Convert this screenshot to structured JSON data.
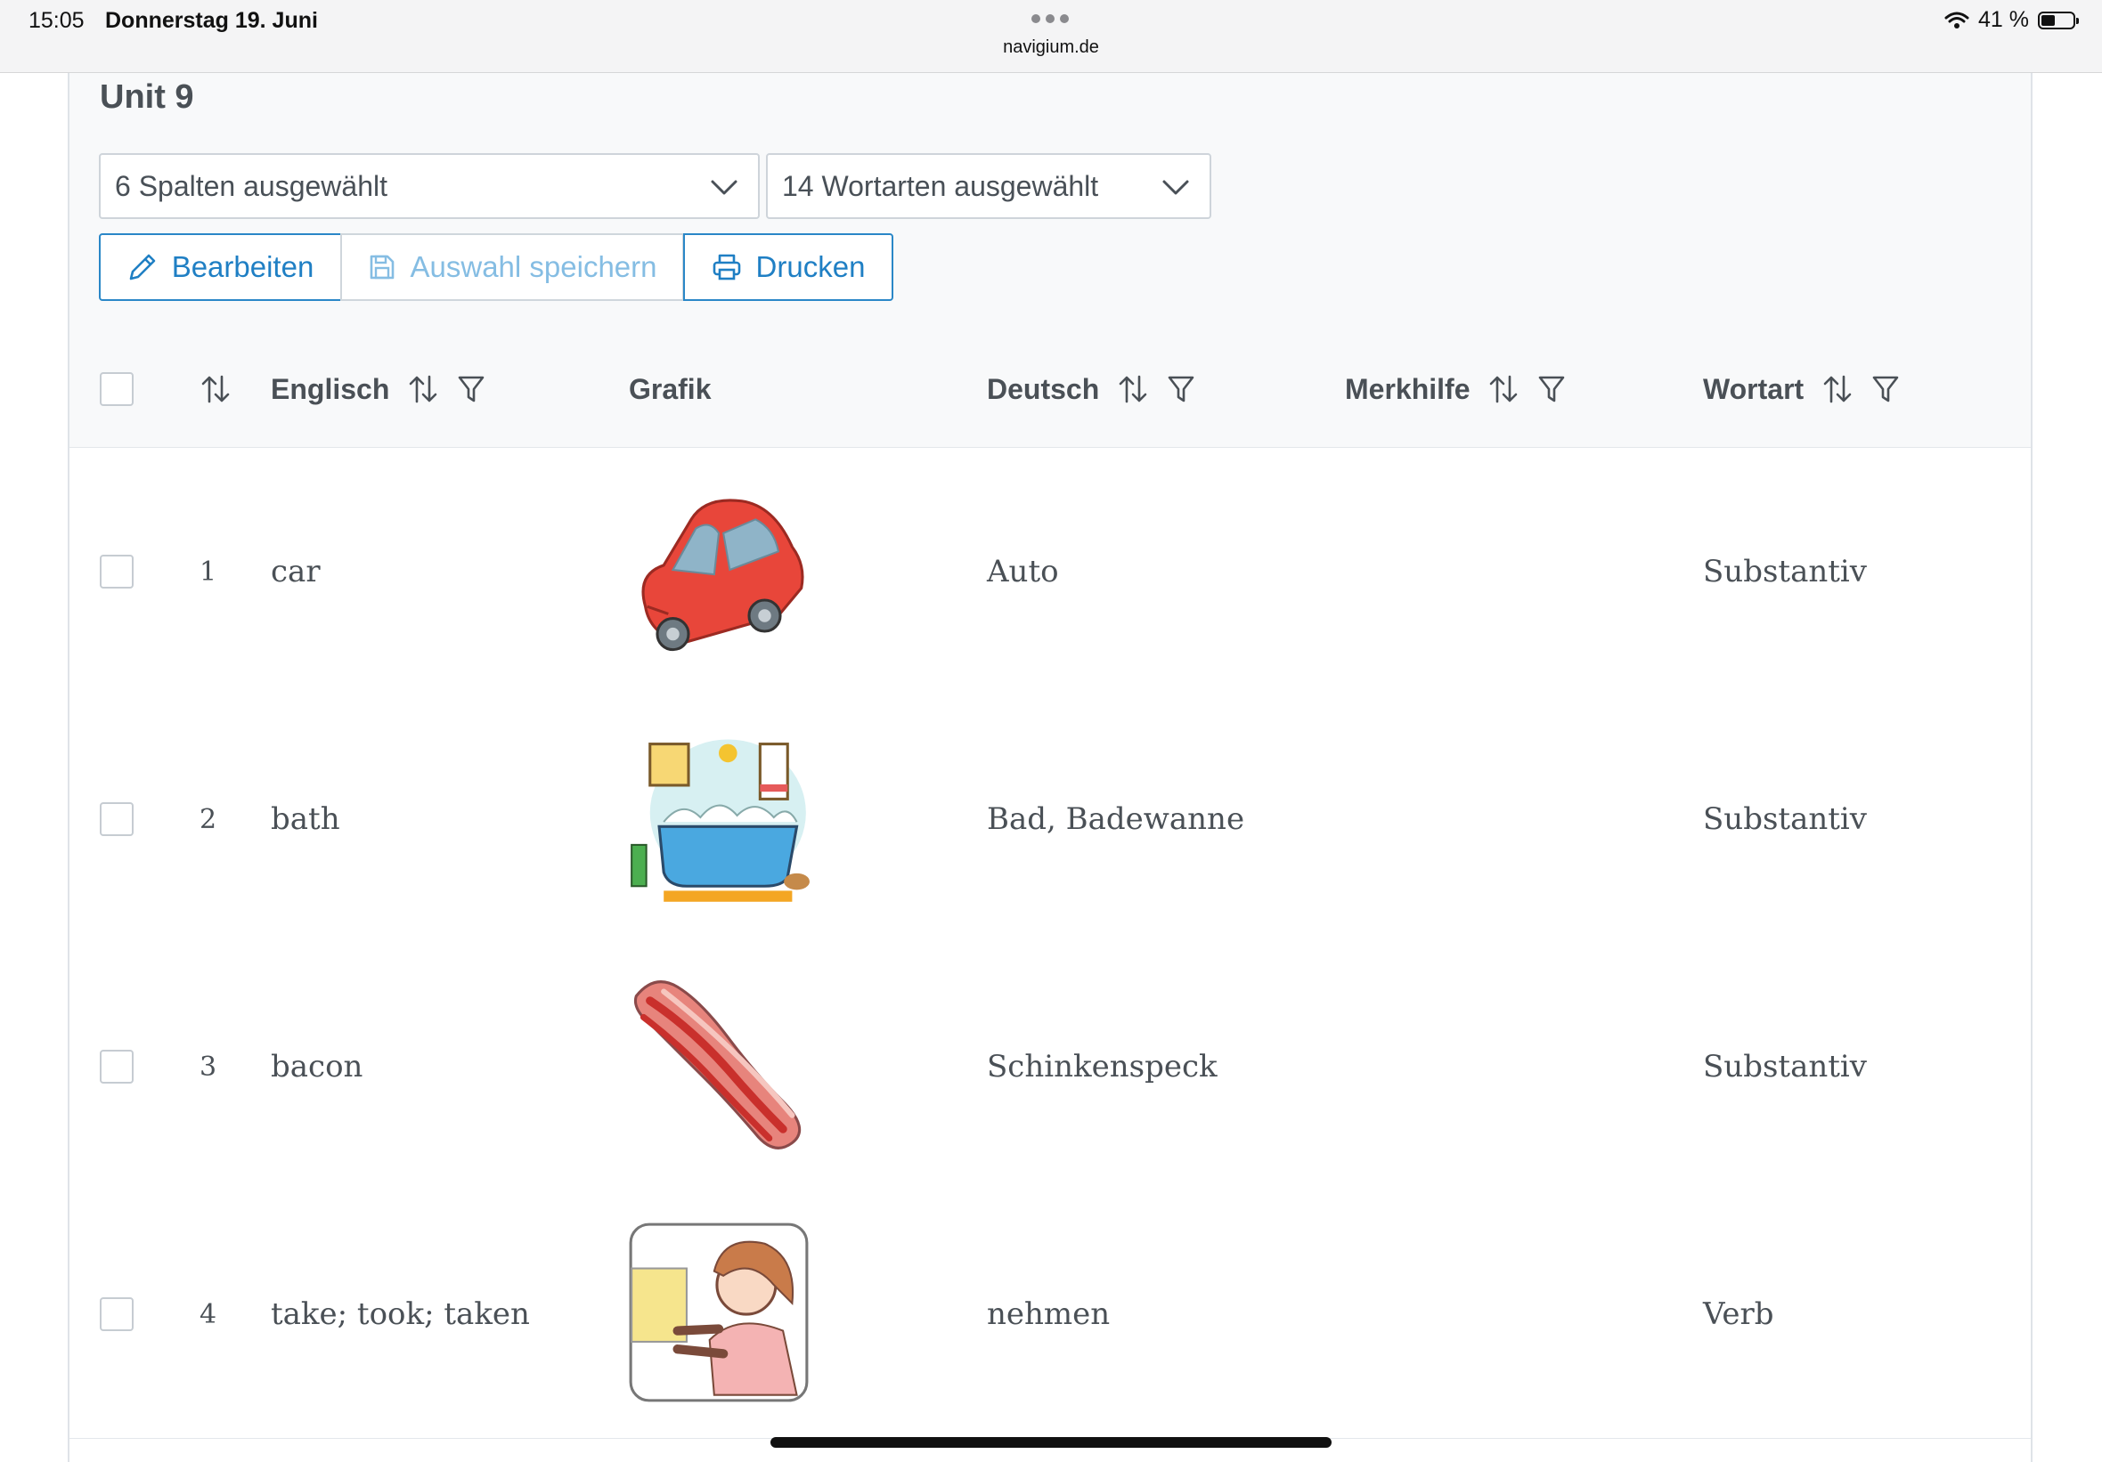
{
  "status_bar": {
    "time": "15:05",
    "date": "Donnerstag 19. Juni",
    "url": "navigium.de",
    "battery": "41 %"
  },
  "page": {
    "title": "Unit 9",
    "columns_select": "6 Spalten ausgewählt",
    "wordtypes_select": "14 Wortarten ausgewählt",
    "buttons": {
      "edit": "Bearbeiten",
      "save_selection": "Auswahl speichern",
      "print": "Drucken"
    }
  },
  "table": {
    "headers": {
      "english": "Englisch",
      "graphic": "Grafik",
      "german": "Deutsch",
      "mnemonic": "Merkhilfe",
      "wordtype": "Wortart"
    },
    "rows": [
      {
        "num": "1",
        "english": "car",
        "icon": "car-image",
        "german": "Auto",
        "mnemonic": "",
        "wordtype": "Substantiv"
      },
      {
        "num": "2",
        "english": "bath",
        "icon": "bathtub-image",
        "german": "Bad, Badewanne",
        "mnemonic": "",
        "wordtype": "Substantiv"
      },
      {
        "num": "3",
        "english": "bacon",
        "icon": "bacon-image",
        "german": "Schinkenspeck",
        "mnemonic": "",
        "wordtype": "Substantiv"
      },
      {
        "num": "4",
        "english": "take; took; taken",
        "icon": "person-taking-image",
        "german": "nehmen",
        "mnemonic": "",
        "wordtype": "Verb"
      }
    ]
  },
  "colors": {
    "accent": "#1f7fc4",
    "header_bg": "#f8f9fa",
    "border": "#e4e7eb"
  }
}
